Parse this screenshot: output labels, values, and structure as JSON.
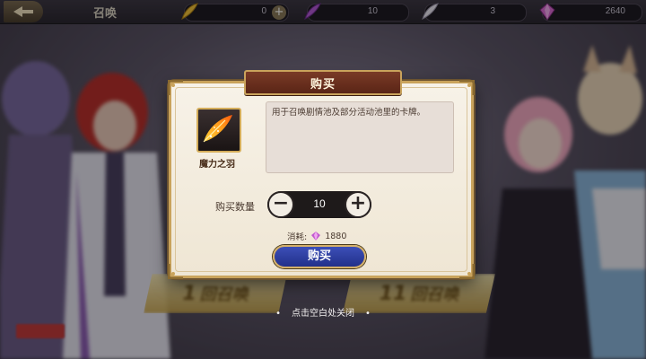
{
  "topbar": {
    "title": "召唤",
    "currencies": [
      {
        "icon": "gold-quill-icon",
        "value": "0",
        "has_plus": true
      },
      {
        "icon": "purple-quill-icon",
        "value": "10",
        "has_plus": false
      },
      {
        "icon": "white-quill-icon",
        "value": "3",
        "has_plus": false
      },
      {
        "icon": "magic-gem-icon",
        "value": "2640",
        "has_plus": false
      }
    ]
  },
  "background": {
    "summon_once": {
      "main": "1",
      "suffix": "回召唤"
    },
    "summon_eleven": {
      "main": "11",
      "suffix": "回召唤"
    }
  },
  "dialog": {
    "title": "购买",
    "item_name": "魔力之羽",
    "description": "用于召唤剧情池及部分活动池里的卡牌。",
    "quantity_label": "购买数量",
    "quantity": "10",
    "cost_label": "消耗:",
    "cost_value": "1880",
    "buy_button": "购买"
  },
  "close_hint": "点击空白处关闭",
  "colors": {
    "accent_gold": "#c9a35c",
    "title_bg": "#6a2e1e",
    "buy_button": "#2e3fa0",
    "dialog_bg": "#f4eee0"
  }
}
